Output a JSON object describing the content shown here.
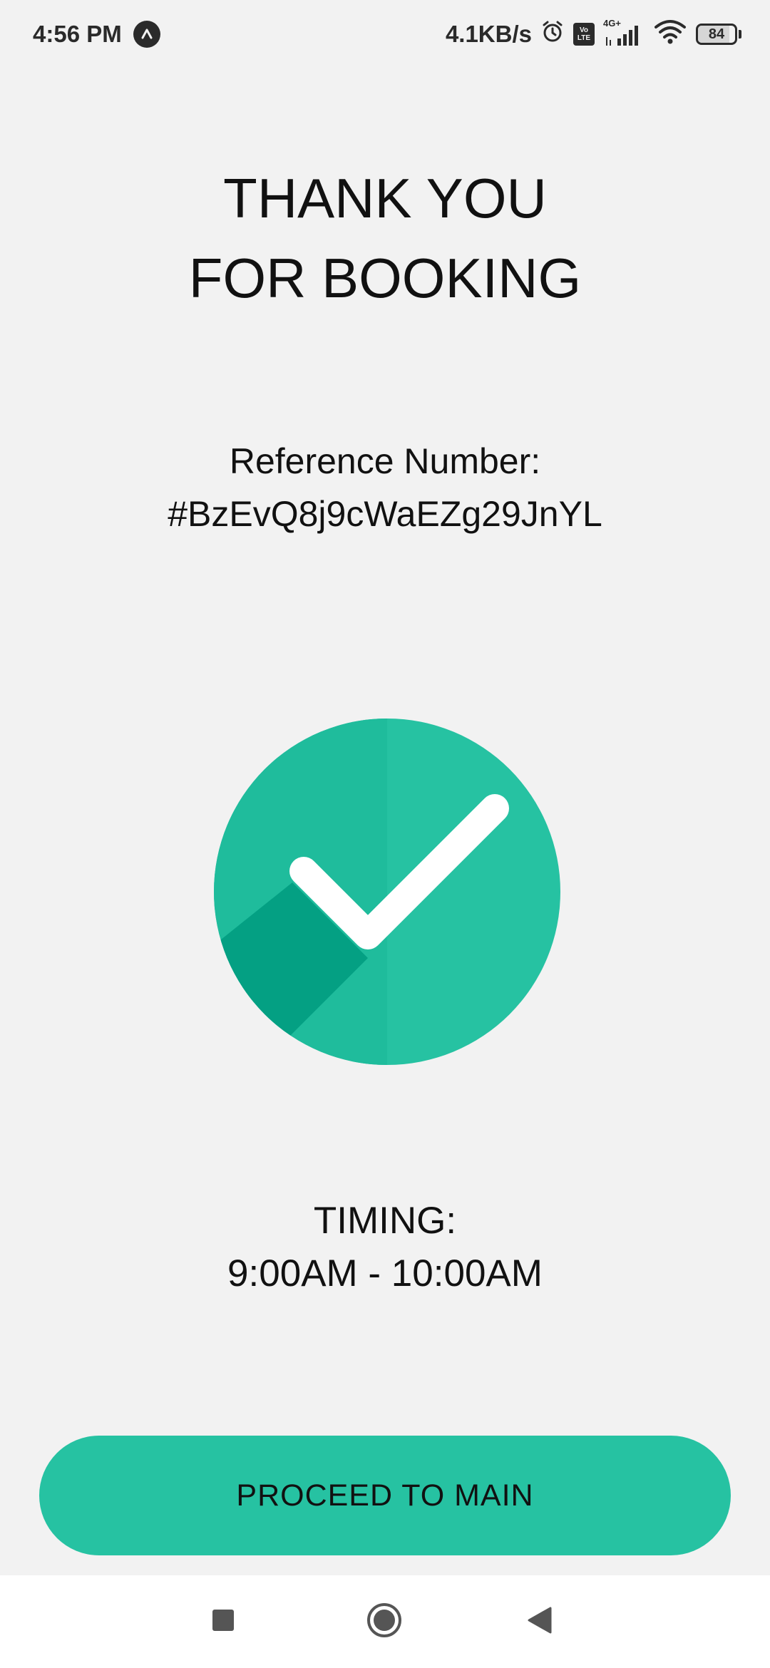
{
  "status_bar": {
    "time": "4:56 PM",
    "net_speed": "4.1KB/s",
    "lte_top": "Vo",
    "lte_bottom": "LTE",
    "network_type": "4G+",
    "battery_level": "84",
    "battery_fraction": 0.84,
    "icons": [
      "app-notification-icon",
      "alarm-icon",
      "volte-icon",
      "signal-icon",
      "wifi-icon",
      "battery-icon"
    ]
  },
  "main": {
    "title_line1": "THANK YOU",
    "title_line2": "FOR BOOKING",
    "reference_label": "Reference Number:",
    "reference_value": "#BzEvQ8j9cWaEZg29JnYL",
    "timing_label": "TIMING:",
    "timing_value": "9:00AM - 10:00AM",
    "success_icon": "check-circle-icon"
  },
  "actions": {
    "proceed_label": "PROCEED TO MAIN"
  },
  "nav_bar": {
    "icons": [
      "recents-square-icon",
      "home-circle-icon",
      "back-triangle-icon"
    ]
  },
  "colors": {
    "background": "#f2f2f2",
    "accent": "#26c2a2",
    "accent_dark": "#1fbc9c",
    "accent_shadow": "#04a083",
    "check": "#ffffff",
    "nav_background": "#ffffff"
  }
}
